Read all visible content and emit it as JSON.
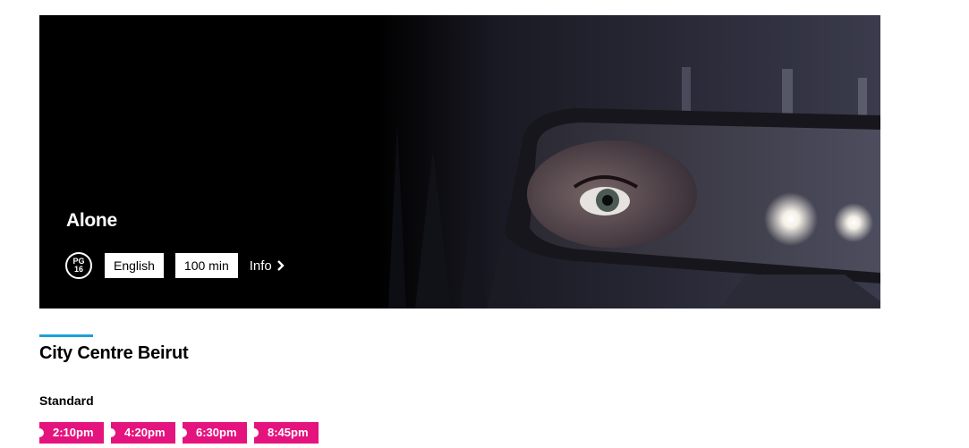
{
  "movie": {
    "title": "Alone",
    "rating_line1": "PG",
    "rating_line2": "16",
    "language": "English",
    "duration": "100 min",
    "info_label": "Info"
  },
  "cinema": {
    "name": "City Centre Beirut",
    "accent_color": "#1ba0d8"
  },
  "format": {
    "label": "Standard",
    "showtimes": [
      "2:10pm",
      "4:20pm",
      "6:30pm",
      "8:45pm"
    ],
    "showtime_color": "#e5137e"
  },
  "icons": {
    "info": "chevron-right-icon",
    "rating": "rating-badge-icon"
  }
}
